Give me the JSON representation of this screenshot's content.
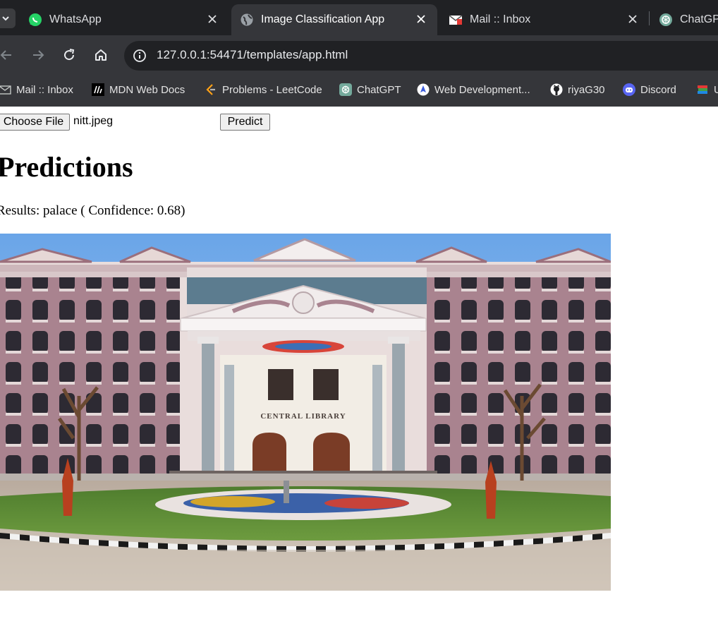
{
  "browser": {
    "tabs": [
      {
        "title": "WhatsApp",
        "icon": "whatsapp-icon",
        "active": false
      },
      {
        "title": "Image Classification App",
        "icon": "globe-icon",
        "active": true
      },
      {
        "title": "Mail :: Inbox",
        "icon": "mail-icon",
        "active": false
      },
      {
        "title": "ChatGPT",
        "icon": "chatgpt-icon",
        "active": false
      }
    ],
    "url": "127.0.0.1:54471/templates/app.html",
    "bookmarks": [
      {
        "label": "Mail :: Inbox",
        "icon": "mail-icon"
      },
      {
        "label": "MDN Web Docs",
        "icon": "mdn-icon"
      },
      {
        "label": "Problems - LeetCode",
        "icon": "leetcode-icon"
      },
      {
        "label": "ChatGPT",
        "icon": "chatgpt-icon"
      },
      {
        "label": "Web Development...",
        "icon": "web-dev-icon"
      },
      {
        "label": "riyaG30",
        "icon": "github-icon"
      },
      {
        "label": "Discord",
        "icon": "discord-icon"
      },
      {
        "label": "U",
        "icon": "books-icon"
      }
    ]
  },
  "form": {
    "choose_file_label": "Choose File",
    "file_name": "nitt.jpeg",
    "predict_label": "Predict"
  },
  "predictions": {
    "heading": "Predictions",
    "results_prefix": "Results: ",
    "label": "palace",
    "confidence_text": " ( Confidence: 0.68)"
  },
  "image": {
    "sign_text": "CENTRAL LIBRARY"
  },
  "colors": {
    "chrome_dark": "#202124",
    "toolbar": "#35363a",
    "whatsapp_green": "#25d366",
    "discord_blue": "#5865f2"
  }
}
